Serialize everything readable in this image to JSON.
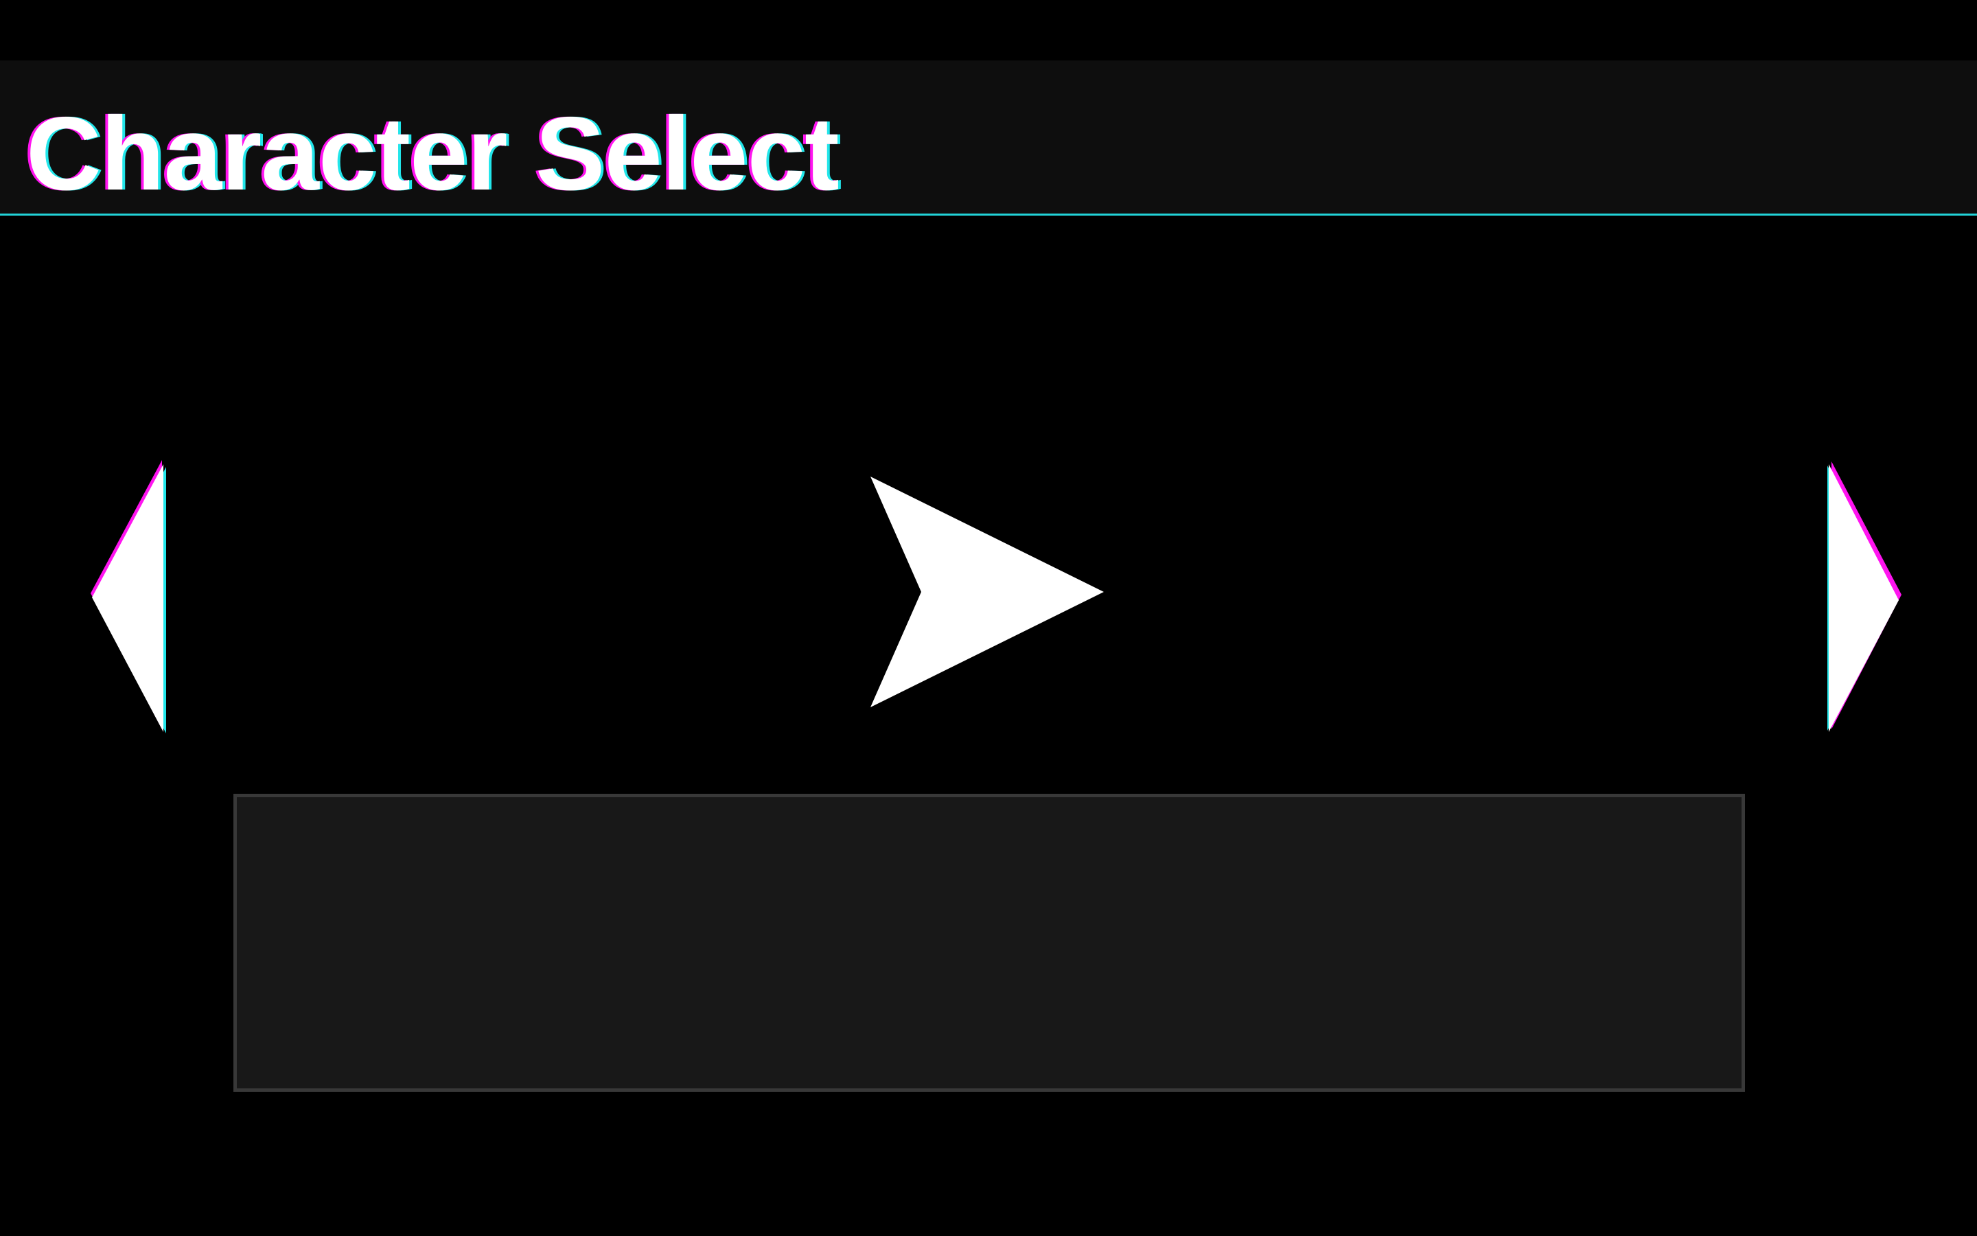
{
  "header": {
    "title": "Character Select"
  },
  "carousel": {
    "prev_icon": "triangle-left-icon",
    "next_icon": "triangle-right-icon",
    "character_icon": "arrowhead-right-icon"
  },
  "info_panel": {
    "text": ""
  },
  "colors": {
    "background": "#000000",
    "header_bg": "#0e0e0e",
    "accent_cyan": "#22d3d8",
    "accent_magenta": "#ff14f0",
    "panel_bg": "#181818",
    "panel_border": "#383838"
  }
}
